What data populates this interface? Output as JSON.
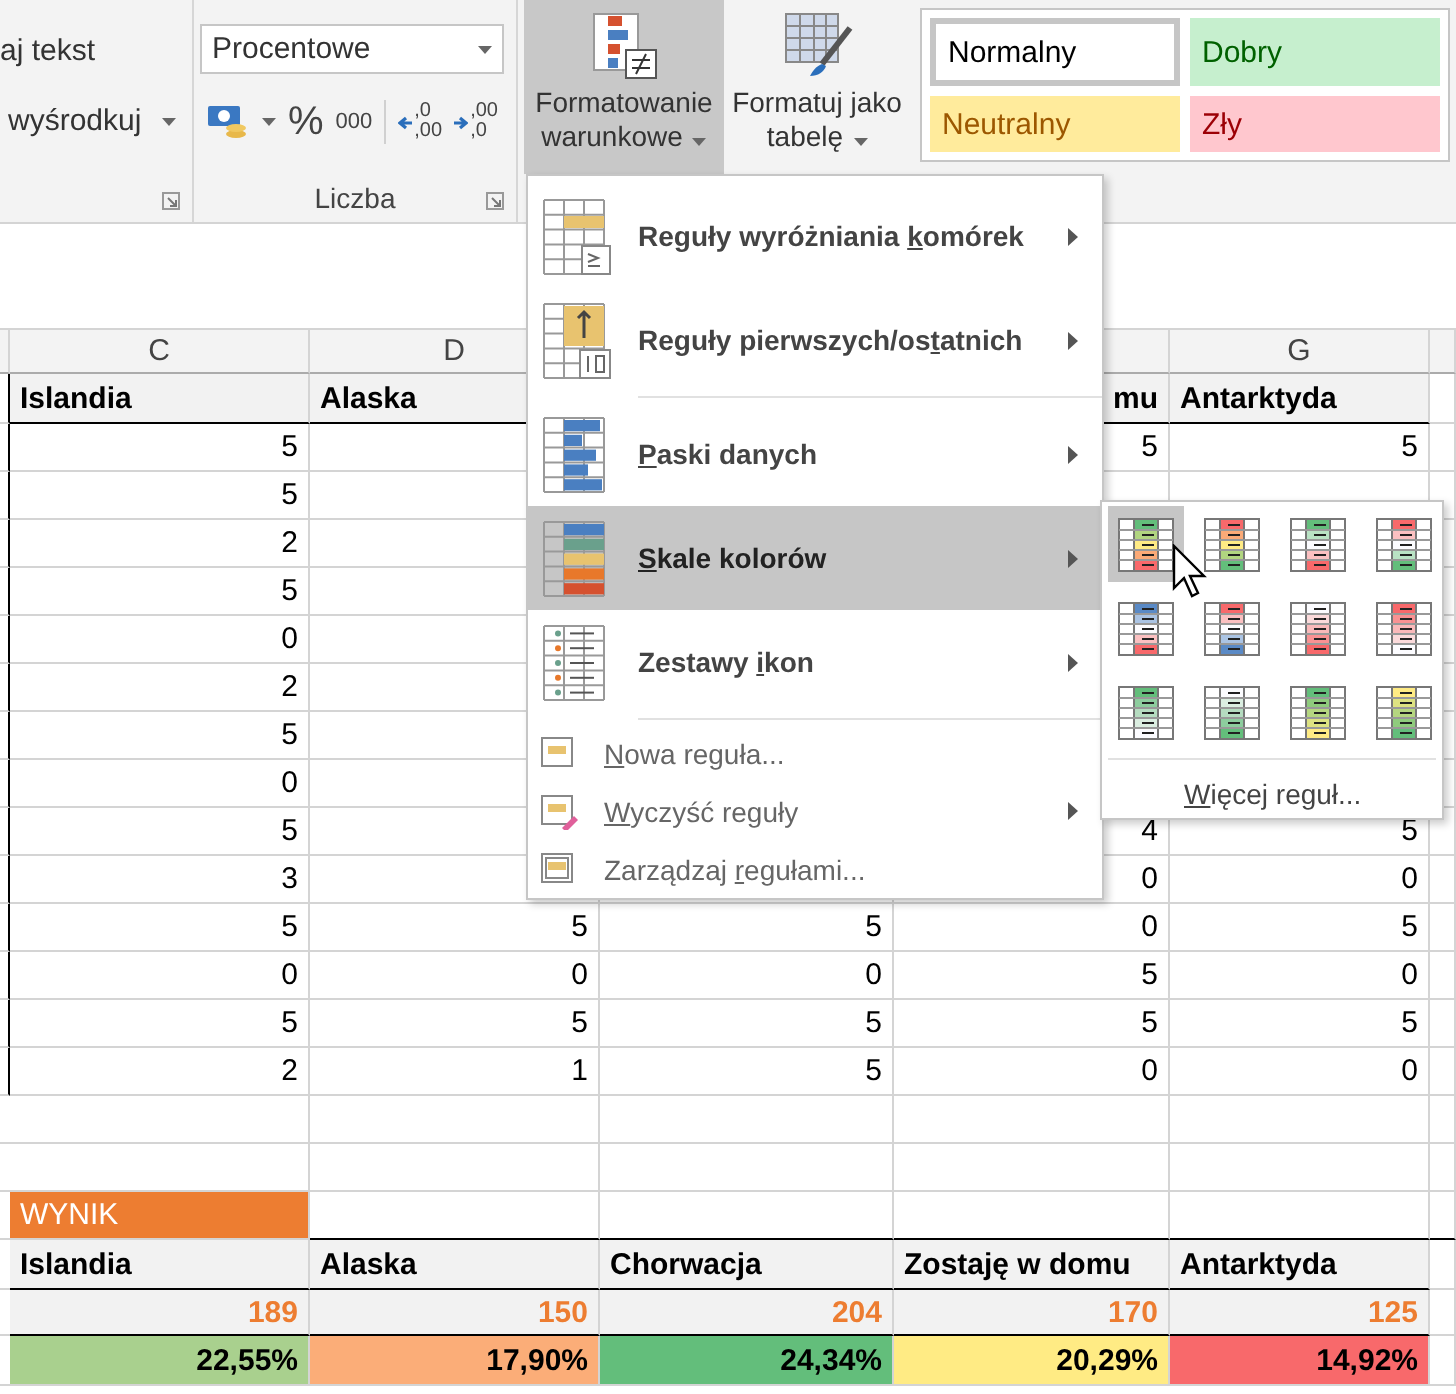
{
  "ribbon": {
    "alignment_group": {
      "wrap_text": "aj tekst",
      "merge_center": "wyśrodkuj"
    },
    "number_group": {
      "format": "Procentowe",
      "percent": "%",
      "thousands": "000",
      "increase_decimal": [
        ",0",
        ",00"
      ],
      "decrease_decimal": [
        ",00",
        ",0"
      ],
      "label": "Liczba"
    },
    "conditional_formatting": {
      "label": "Formatowanie warunkowe",
      "pressed": true
    },
    "format_as_table": {
      "label": "Formatuj jako tabelę"
    },
    "cell_styles": [
      {
        "label": "Normalny",
        "kind": "normal",
        "selected": true
      },
      {
        "label": "Dobry",
        "kind": "good",
        "selected": false
      },
      {
        "label": "Neutralny",
        "kind": "neutral",
        "selected": false
      },
      {
        "label": "Zły",
        "kind": "bad",
        "selected": false
      }
    ]
  },
  "sheet": {
    "column_letters": {
      "c": "C",
      "d": "D",
      "g": "G"
    },
    "header": {
      "c": {
        "text": "Islandia",
        "clipped": false
      },
      "d": {
        "text": "Alaska",
        "clipped": false
      },
      "f": {
        "text": "mu",
        "clipped": true
      },
      "g": {
        "text": "Antarktyda",
        "clipped": false
      }
    },
    "rows": [
      {
        "c": "5",
        "f": "5",
        "g": "5"
      },
      {
        "c": "5"
      },
      {
        "c": "2"
      },
      {
        "c": "5"
      },
      {
        "c": "0"
      },
      {
        "c": "2"
      },
      {
        "c": "5"
      },
      {
        "c": "0"
      },
      {
        "c": "5",
        "f": "4",
        "g": "5"
      },
      {
        "c": "3",
        "f": "0",
        "g": "0"
      },
      {
        "c": "5",
        "d": "5",
        "e": "5",
        "f": "0",
        "g": "5"
      },
      {
        "c": "0",
        "d": "0",
        "e": "0",
        "f": "5",
        "g": "0"
      },
      {
        "c": "5",
        "d": "5",
        "e": "5",
        "f": "5",
        "g": "5"
      },
      {
        "c": "2",
        "d": "1",
        "e": "5",
        "f": "0",
        "g": "0"
      }
    ],
    "summary": {
      "title": "WYNIK",
      "columns": [
        {
          "name": "Islandia",
          "count": "189",
          "share": "22,55%",
          "color": "#a9d08e"
        },
        {
          "name": "Alaska",
          "count": "150",
          "share": "17,90%",
          "color": "#fbad78"
        },
        {
          "name": "Chorwacja",
          "count": "204",
          "share": "24,34%",
          "color": "#63be7b"
        },
        {
          "name": "Zostaję w domu",
          "count": "170",
          "share": "20,29%",
          "color": "#ffeb84"
        },
        {
          "name": "Antarktyda",
          "count": "125",
          "share": "14,92%",
          "color": "#f8696b"
        }
      ]
    }
  },
  "conditional_menu": {
    "items": [
      {
        "kind": "large",
        "label_before": "Reguły wyróżniania ",
        "access_key": "k",
        "label_after": "omórek",
        "submenu": true,
        "selected": false,
        "divider_below": false
      },
      {
        "kind": "large",
        "label_before": "Reguły pierwszych/os",
        "access_key": "t",
        "label_after": "atnich",
        "submenu": true,
        "selected": false,
        "divider_below": true
      },
      {
        "kind": "large",
        "access_key": "P",
        "label_after": "aski danych",
        "submenu": true,
        "selected": false,
        "divider_below": false
      },
      {
        "kind": "large",
        "access_key": "S",
        "label_after": "kale kolorów",
        "submenu": true,
        "selected": true,
        "divider_below": false
      },
      {
        "kind": "large",
        "label_before": "Zestawy ",
        "access_key": "i",
        "label_after": "kon",
        "submenu": true,
        "selected": false,
        "divider_below": true
      },
      {
        "kind": "small",
        "access_key": "N",
        "label_after": "owa reguła...",
        "submenu": false,
        "selected": false,
        "divider_below": false
      },
      {
        "kind": "small",
        "access_key": "W",
        "label_after": "yczyść reguły",
        "submenu": true,
        "selected": false,
        "divider_below": false
      },
      {
        "kind": "small",
        "label_before": "Zarządzaj ",
        "access_key": "r",
        "label_after": "egułami...",
        "submenu": false,
        "selected": false,
        "divider_below": false
      }
    ]
  },
  "color_scales_menu": {
    "scales": [
      {
        "kind": "green-yellow-red",
        "selected": true
      },
      {
        "kind": "red-yellow-green",
        "selected": false
      },
      {
        "kind": "green-white-red",
        "selected": false
      },
      {
        "kind": "red-white-green",
        "selected": false
      },
      {
        "kind": "blue-white-red",
        "selected": false
      },
      {
        "kind": "red-white-blue",
        "selected": false
      },
      {
        "kind": "white-red",
        "selected": false
      },
      {
        "kind": "red-white",
        "selected": false
      },
      {
        "kind": "green-white",
        "selected": false
      },
      {
        "kind": "white-green",
        "selected": false
      },
      {
        "kind": "green-yellow",
        "selected": false
      },
      {
        "kind": "yellow-green",
        "selected": false
      }
    ],
    "more": {
      "access_key": "W",
      "label_after": "ięcej reguł..."
    }
  }
}
